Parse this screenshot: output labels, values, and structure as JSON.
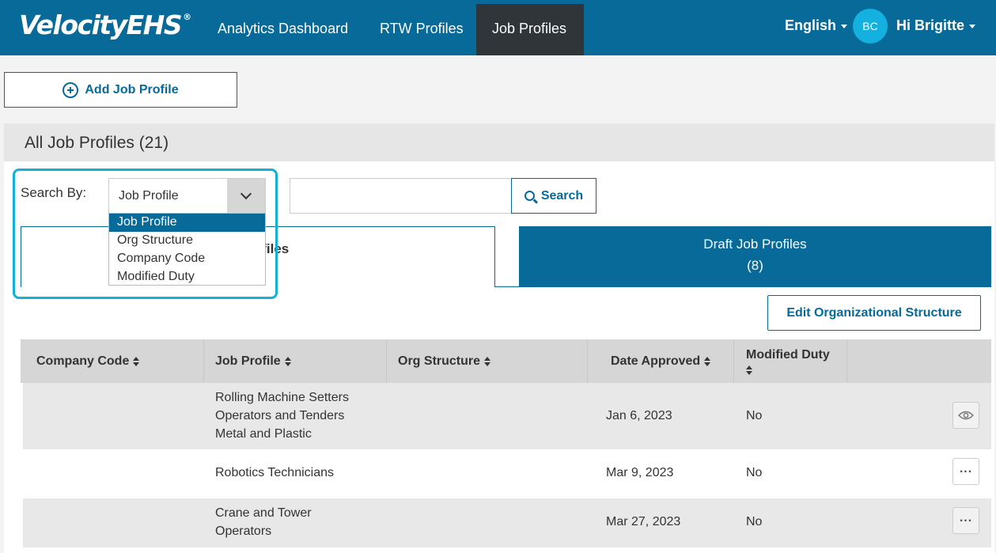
{
  "header": {
    "logo_text": "VelocityEHS",
    "logo_mark": "®",
    "nav": [
      {
        "label": "Analytics Dashboard",
        "active": false
      },
      {
        "label": "RTW Profiles",
        "active": false
      },
      {
        "label": "Job Profiles",
        "active": true
      }
    ],
    "language": "English",
    "avatar_initials": "BC",
    "user_greeting": "Hi Brigitte"
  },
  "toolbar": {
    "add_label": "Add Job Profile"
  },
  "panel": {
    "title": "All Job Profiles (21)"
  },
  "search": {
    "label": "Search By:",
    "selected": "Job Profile",
    "options": [
      "Job Profile",
      "Org Structure",
      "Company Code",
      "Modified Duty"
    ],
    "input_value": "",
    "button_label": "Search"
  },
  "tabs": {
    "active_visible_text": "b profiles",
    "active_visible_count": ")",
    "draft_label": "Draft Job Profiles",
    "draft_count": "(8)"
  },
  "edit_org_label": "Edit Organizational Structure",
  "table": {
    "headers": [
      "Company Code",
      "Job Profile",
      "Org Structure",
      "Date Approved",
      "Modified Duty"
    ],
    "rows": [
      {
        "company_code": "",
        "job_profile": [
          "Rolling Machine Setters",
          "Operators and Tenders",
          "Metal and Plastic"
        ],
        "org_structure": "",
        "date_approved": "Jan 6, 2023",
        "modified_duty": "No",
        "action_icon": "eye-icon"
      },
      {
        "company_code": "",
        "job_profile": [
          "Robotics Technicians"
        ],
        "org_structure": "",
        "date_approved": "Mar 9, 2023",
        "modified_duty": "No",
        "action_icon": "more-icon"
      },
      {
        "company_code": "",
        "job_profile": [
          "Crane and Tower",
          "Operators"
        ],
        "org_structure": "",
        "date_approved": "Mar 27, 2023",
        "modified_duty": "No",
        "action_icon": "more-icon"
      }
    ]
  },
  "colors": {
    "brand": "#076a99",
    "highlight": "#14b0d6",
    "nav_active": "#30353a",
    "avatar": "#14b0e0"
  }
}
